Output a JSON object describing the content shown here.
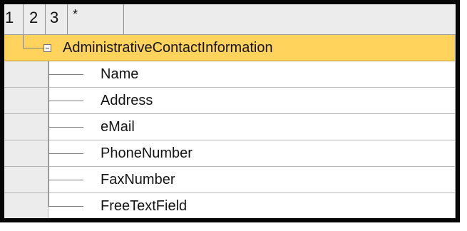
{
  "level_header": {
    "levels": [
      "1",
      "2",
      "3",
      "*"
    ]
  },
  "tree": {
    "root": {
      "label": "AdministrativeContactInformation",
      "expanded": true
    },
    "children": [
      {
        "label": "Name"
      },
      {
        "label": "Address"
      },
      {
        "label": "eMail"
      },
      {
        "label": "PhoneNumber"
      },
      {
        "label": "FaxNumber"
      },
      {
        "label": "FreeTextField"
      }
    ]
  },
  "colors": {
    "selection": "#ffd35c",
    "gutter": "#ececec",
    "grid": "#b7b7b7",
    "tree_lines": "#7f7f7f"
  },
  "icons": {
    "collapse": "minus-box-icon",
    "tree_connector": "tree-line-icon"
  }
}
